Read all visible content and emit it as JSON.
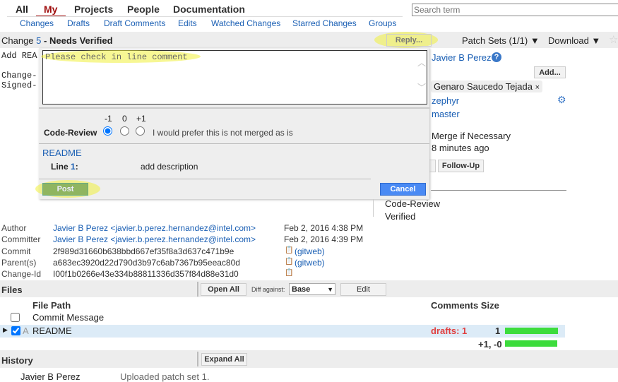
{
  "top_nav": {
    "items": [
      "All",
      "My",
      "Projects",
      "People",
      "Documentation"
    ],
    "active": "My"
  },
  "sub_nav": [
    "Changes",
    "Drafts",
    "Draft Comments",
    "Edits",
    "Watched Changes",
    "Starred Changes",
    "Groups"
  ],
  "search": {
    "placeholder": "Search term"
  },
  "header": {
    "change_label": "Change",
    "change_number": "5",
    "status": "- Needs Verified",
    "reply": "Reply...",
    "patch_sets": "Patch Sets (1/1) ▼",
    "download": "Download ▼"
  },
  "commit_msg_partial": [
    "Add REA",
    "Change-",
    "Signed-"
  ],
  "reply_popup": {
    "message": "Please check in line comment",
    "vote_values": [
      "-1",
      "0",
      "+1"
    ],
    "label": "Code-Review",
    "vote_desc": "I would prefer this is not merged as is",
    "selected": "-1",
    "file": "README",
    "line_label": "Line",
    "line_num": "1",
    "line_sep": ":",
    "comment": "add description",
    "post": "Post",
    "cancel": "Cancel"
  },
  "side": {
    "owner": "Javier B Perez",
    "add": "Add...",
    "reviewer": "Genaro Saucedo Tejada",
    "remove": "×",
    "project": "zephyr",
    "branch": "master",
    "strategy": "Merge if Necessary",
    "updated": "8 minutes ago",
    "follow_up": "Follow-Up",
    "labels": [
      "Code-Review",
      "Verified"
    ]
  },
  "commit_info": {
    "rows": [
      {
        "label": "Author",
        "value": "Javier B Perez <javier.b.perez.hernandez@intel.com>",
        "extra": "Feb 2, 2016 4:38 PM"
      },
      {
        "label": "Committer",
        "value": "Javier B Perez <javier.b.perez.hernandez@intel.com>",
        "extra": "Feb 2, 2016 4:39 PM"
      },
      {
        "label": "Commit",
        "value": "2f989d31660b638bbd667ef35f8a3d637c471b9e",
        "extra": "(gitweb)"
      },
      {
        "label": "Parent(s)",
        "value": "a683ec3920d22d790d3b97c6ab7367b95eeac80d",
        "extra": "(gitweb)"
      },
      {
        "label": "Change-Id",
        "value": "I00f1b0266e43e334b88811336d357f84d88e31d0",
        "extra": ""
      }
    ]
  },
  "files": {
    "title": "Files",
    "open_all": "Open All",
    "diff_against": "Diff against:",
    "diff_base": "Base",
    "edit": "Edit",
    "col_path": "File Path",
    "col_comments_size": "Comments Size",
    "rows": [
      {
        "path": "Commit Message",
        "checked": false
      },
      {
        "status": "A",
        "path": "README",
        "checked": true,
        "comments": "drafts: 1",
        "size": "1"
      }
    ],
    "total": "+1, -0"
  },
  "history": {
    "title": "History",
    "expand_all": "Expand All",
    "rows": [
      {
        "author": "Javier B Perez",
        "message": "Uploaded patch set 1."
      }
    ]
  }
}
